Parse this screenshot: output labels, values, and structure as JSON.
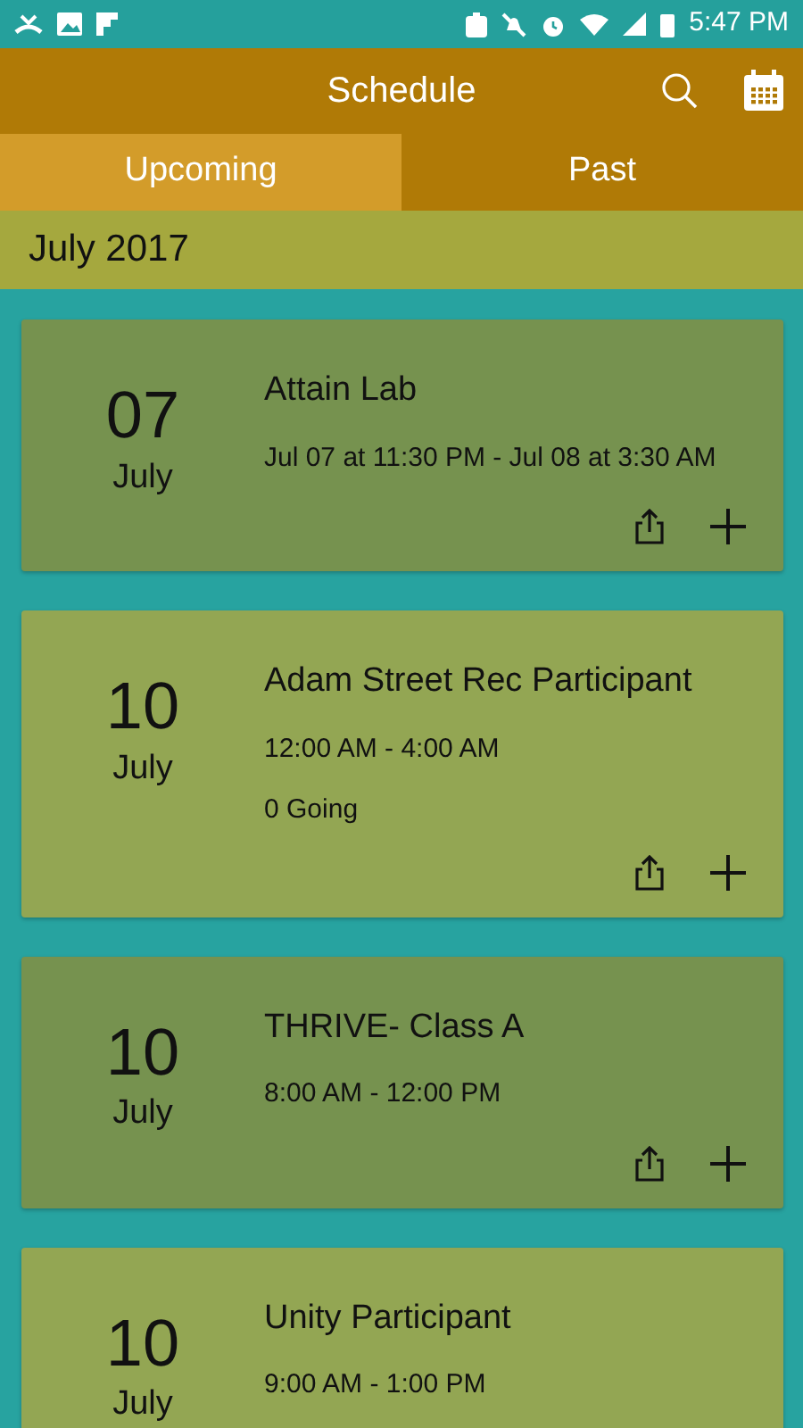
{
  "status_bar": {
    "time": "5:47 PM"
  },
  "app_bar": {
    "title": "Schedule"
  },
  "tabs": [
    {
      "label": "Upcoming",
      "selected": true
    },
    {
      "label": "Past",
      "selected": false
    }
  ],
  "month_header": "July 2017",
  "events": [
    {
      "day": "07",
      "month": "July",
      "title": "Attain Lab",
      "time": "Jul 07 at 11:30 PM - Jul 08 at 3:30 AM",
      "color": "#76924f",
      "actions": true
    },
    {
      "day": "10",
      "month": "July",
      "title": "Adam Street Rec Participant",
      "time": "12:00 AM - 4:00 AM",
      "going": "0 Going",
      "color": "#93a653",
      "actions": true
    },
    {
      "day": "10",
      "month": "July",
      "title": "THRIVE- Class A",
      "time": "8:00 AM - 12:00 PM",
      "color": "#76924f",
      "actions": true
    },
    {
      "day": "10",
      "month": "July",
      "title": "Unity Participant",
      "time": "9:00 AM - 1:00 PM",
      "color": "#93a653",
      "actions": false
    }
  ]
}
